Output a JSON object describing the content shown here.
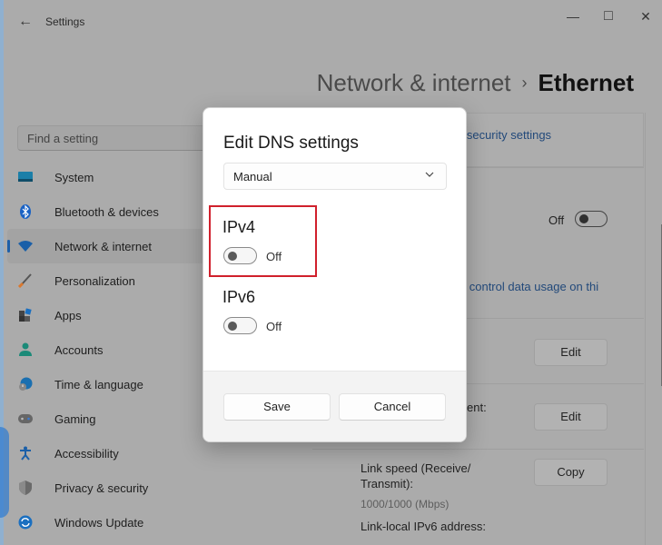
{
  "window": {
    "title": "Settings",
    "back_icon": "←",
    "minimize_icon": "—",
    "maximize_icon": "□",
    "close_icon": "✕"
  },
  "breadcrumb": {
    "parent": "Network & internet",
    "separator": "›",
    "current": "Ethernet"
  },
  "search": {
    "placeholder": "Find a setting"
  },
  "sidebar": {
    "active_index": 2,
    "items": [
      {
        "label": "System",
        "icon": "system-icon",
        "color": "#1b7fa8"
      },
      {
        "label": "Bluetooth & devices",
        "icon": "bluetooth-icon",
        "color": "#1a62c4"
      },
      {
        "label": "Network & internet",
        "icon": "wifi-icon",
        "color": "#1a5fa8"
      },
      {
        "label": "Personalization",
        "icon": "brush-icon",
        "color": "#c26a2a"
      },
      {
        "label": "Apps",
        "icon": "apps-icon",
        "color": "#333333"
      },
      {
        "label": "Accounts",
        "icon": "account-icon",
        "color": "#1b8a78"
      },
      {
        "label": "Time & language",
        "icon": "globe-clock-icon",
        "color": "#1a6fb0"
      },
      {
        "label": "Gaming",
        "icon": "gamepad-icon",
        "color": "#555555"
      },
      {
        "label": "Accessibility",
        "icon": "accessibility-icon",
        "color": "#1a5fa8"
      },
      {
        "label": "Privacy & security",
        "icon": "shield-icon",
        "color": "#5b5b5b"
      },
      {
        "label": "Windows Update",
        "icon": "update-icon",
        "color": "#1a6fc0"
      }
    ]
  },
  "background": {
    "security_link": "d security settings",
    "metered_toggle_label": "Off",
    "data_usage_link": "lp control data usage on thi",
    "edit_button_1": "Edit",
    "dns_assignment_fragment": "ent:",
    "edit_button_2": "Edit",
    "link_speed_label": "Link speed (Receive/",
    "link_speed_label2": "Transmit):",
    "link_speed_value": "1000/1000 (Mbps)",
    "copy_button": "Copy",
    "link_local_label": "Link-local IPv6 address:"
  },
  "dialog": {
    "title": "Edit DNS settings",
    "mode_select": {
      "value": "Manual",
      "chevron": "⌄"
    },
    "ipv4": {
      "label": "IPv4",
      "toggle_state": "Off",
      "highlighted": true
    },
    "ipv6": {
      "label": "IPv6",
      "toggle_state": "Off"
    },
    "save_label": "Save",
    "cancel_label": "Cancel"
  },
  "colors": {
    "highlight_border": "#d0202c",
    "accent": "#1d5fa8"
  }
}
